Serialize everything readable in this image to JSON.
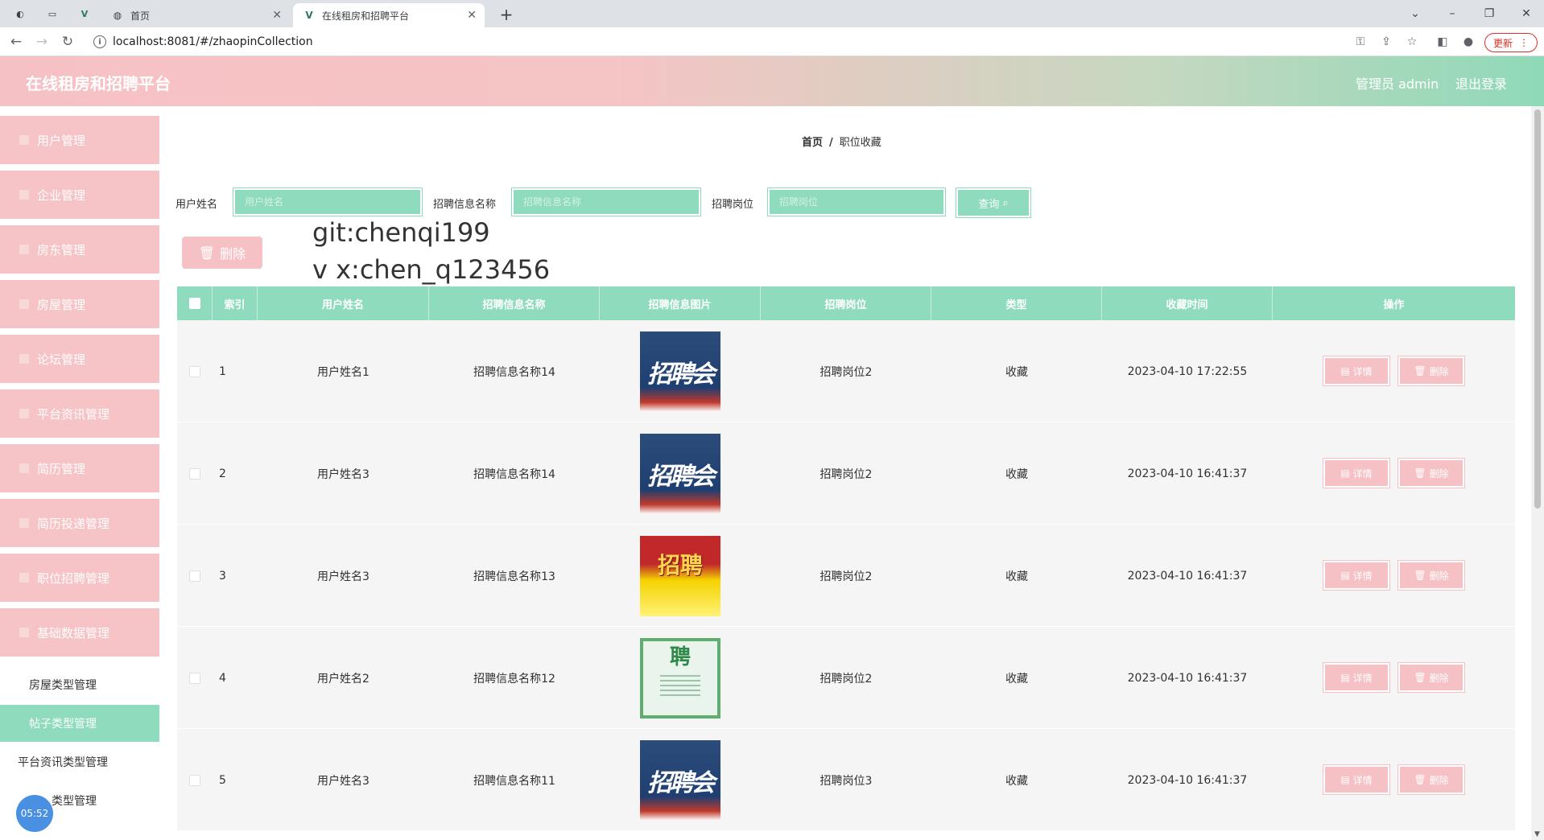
{
  "browser": {
    "tabs": [
      {
        "title": "首页",
        "icon": "globe-icon"
      },
      {
        "title": "在线租房和招聘平台",
        "icon": "vue-icon"
      }
    ],
    "url": "localhost:8081/#/zhaopinCollection",
    "update_label": "更新"
  },
  "app": {
    "title": "在线租房和招聘平台",
    "admin_label": "管理员 admin",
    "logout_label": "退出登录"
  },
  "sidebar": {
    "menu": [
      "用户管理",
      "企业管理",
      "房东管理",
      "房屋管理",
      "论坛管理",
      "平台资讯管理",
      "简历管理",
      "简历投递管理",
      "职位招聘管理",
      "基础数据管理"
    ],
    "sub_items": [
      "房屋类型管理",
      "帖子类型管理",
      "平台资讯类型管理",
      "类型管理"
    ],
    "active_sub": 1,
    "clock": "05:52"
  },
  "breadcrumb": {
    "home": "首页",
    "sep": "/",
    "current": "职位收藏"
  },
  "search": {
    "username_label": "用户姓名",
    "username_placeholder": "用户姓名",
    "name_label": "招聘信息名称",
    "name_placeholder": "招聘信息名称",
    "post_label": "招聘岗位",
    "post_placeholder": "招聘岗位",
    "query_label": "查询"
  },
  "delete_label": "删除",
  "watermark": [
    "git:chenqi199",
    "v x:chen_q123456"
  ],
  "table": {
    "columns": [
      "索引",
      "用户姓名",
      "招聘信息名称",
      "招聘信息图片",
      "招聘岗位",
      "类型",
      "收藏时间",
      "操作"
    ],
    "detail_label": "详情",
    "delete_label": "删除",
    "rows": [
      {
        "index": "1",
        "user": "用户姓名1",
        "name": "招聘信息名称14",
        "image": "blue",
        "image_text": "招聘会",
        "post": "招聘岗位2",
        "type": "收藏",
        "time": "2023-04-10 17:22:55"
      },
      {
        "index": "2",
        "user": "用户姓名3",
        "name": "招聘信息名称14",
        "image": "blue",
        "image_text": "招聘会",
        "post": "招聘岗位2",
        "type": "收藏",
        "time": "2023-04-10 16:41:37"
      },
      {
        "index": "3",
        "user": "用户姓名3",
        "name": "招聘信息名称13",
        "image": "yellow",
        "image_text": "招聘",
        "post": "招聘岗位2",
        "type": "收藏",
        "time": "2023-04-10 16:41:37"
      },
      {
        "index": "4",
        "user": "用户姓名2",
        "name": "招聘信息名称12",
        "image": "green",
        "image_text": "聘",
        "post": "招聘岗位2",
        "type": "收藏",
        "time": "2023-04-10 16:41:37"
      },
      {
        "index": "5",
        "user": "用户姓名3",
        "name": "招聘信息名称11",
        "image": "blue",
        "image_text": "招聘会",
        "post": "招聘岗位3",
        "type": "收藏",
        "time": "2023-04-10 16:41:37"
      }
    ]
  }
}
